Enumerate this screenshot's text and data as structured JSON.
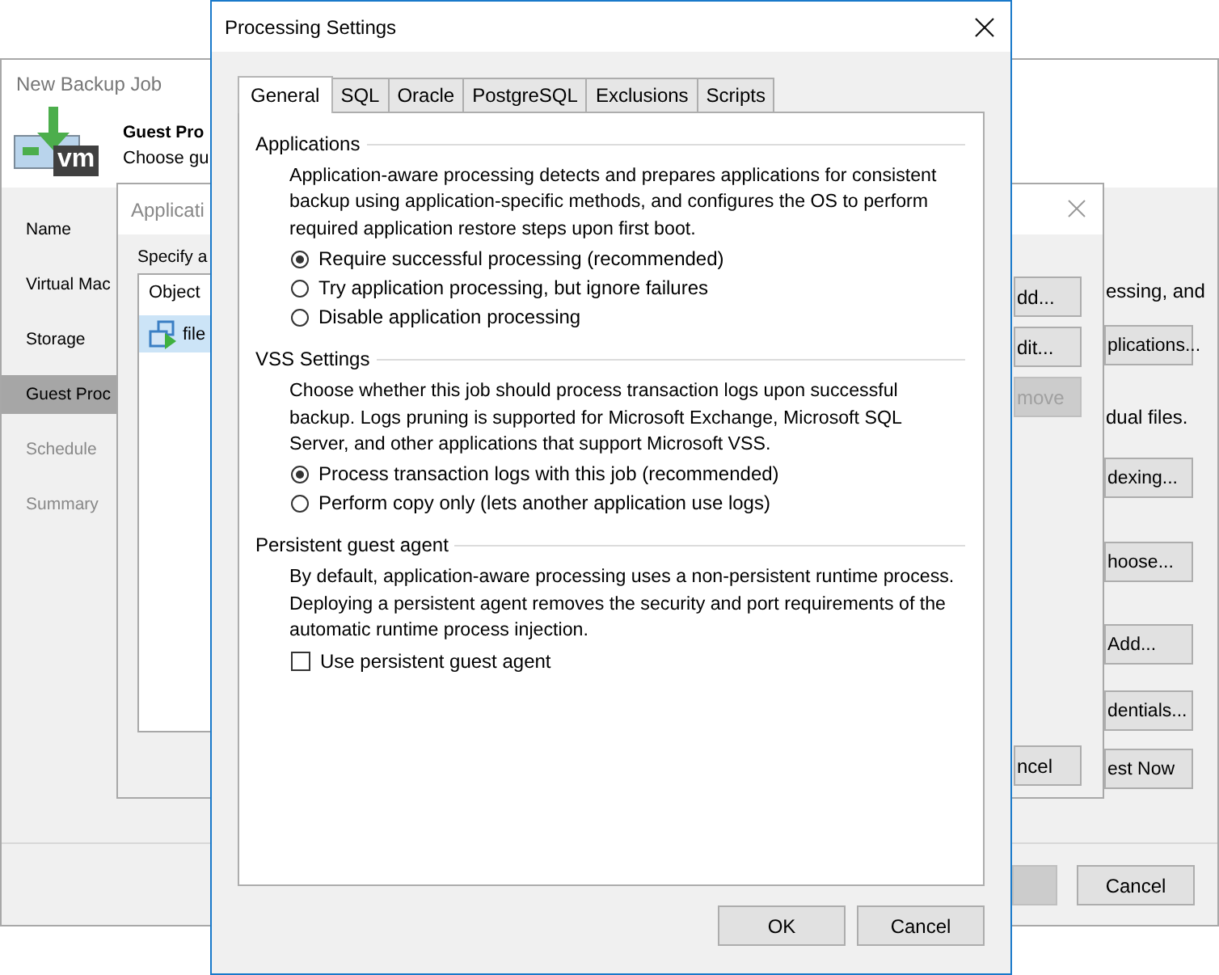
{
  "background_window": {
    "title": "New Backup Job",
    "logo_text": "vm",
    "header_title": "Guest Pro",
    "header_subtitle": "Choose gu",
    "steps": [
      {
        "label": "Name",
        "selected": false,
        "disabled": false
      },
      {
        "label": "Virtual Mac",
        "selected": false,
        "disabled": false
      },
      {
        "label": "Storage",
        "selected": false,
        "disabled": false
      },
      {
        "label": "Guest Proc",
        "selected": true,
        "disabled": false
      },
      {
        "label": "Schedule",
        "selected": false,
        "disabled": true
      },
      {
        "label": "Summary",
        "selected": false,
        "disabled": true
      }
    ],
    "right_items": [
      {
        "kind": "text",
        "label": "essing, and"
      },
      {
        "kind": "button",
        "label": "plications..."
      },
      {
        "kind": "text",
        "label": "dual files."
      },
      {
        "kind": "button",
        "label": "dexing..."
      },
      {
        "kind": "button",
        "label": "hoose..."
      },
      {
        "kind": "button",
        "label": "Add..."
      },
      {
        "kind": "button",
        "label": "dentials..."
      },
      {
        "kind": "button",
        "label": "est Now"
      }
    ],
    "cancel_button": "Cancel"
  },
  "middle_window": {
    "title": "Applicati",
    "prompt": "Specify a",
    "list_header": "Object",
    "rows": [
      {
        "label": "file",
        "selected": true
      }
    ],
    "buttons": [
      {
        "label": "dd...",
        "disabled": false
      },
      {
        "label": "dit...",
        "disabled": false
      },
      {
        "label": "move",
        "disabled": true
      },
      {
        "label": "ncel",
        "disabled": false
      }
    ]
  },
  "window": {
    "title": "Processing Settings",
    "tabs": [
      {
        "label": "General",
        "selected": true
      },
      {
        "label": "SQL",
        "selected": false
      },
      {
        "label": "Oracle",
        "selected": false
      },
      {
        "label": "PostgreSQL",
        "selected": false
      },
      {
        "label": "Exclusions",
        "selected": false
      },
      {
        "label": "Scripts",
        "selected": false
      }
    ],
    "sections": [
      {
        "heading": "Applications",
        "description": "Application-aware processing detects and prepares applications for consistent backup using application-specific methods, and configures the OS to perform required application restore steps upon first boot.",
        "options": [
          {
            "kind": "radio",
            "label": "Require successful processing (recommended)",
            "checked": true
          },
          {
            "kind": "radio",
            "label": "Try application processing, but ignore failures",
            "checked": false
          },
          {
            "kind": "radio",
            "label": "Disable application processing",
            "checked": false
          }
        ]
      },
      {
        "heading": "VSS Settings",
        "description": "Choose whether this job should process transaction logs upon successful backup. Logs pruning is supported for Microsoft Exchange, Microsoft SQL Server, and other applications that support Microsoft VSS.",
        "options": [
          {
            "kind": "radio",
            "label": "Process transaction logs with this job (recommended)",
            "checked": true
          },
          {
            "kind": "radio",
            "label": "Perform copy only (lets another application use logs)",
            "checked": false
          }
        ]
      },
      {
        "heading": "Persistent guest agent",
        "description": "By default, application-aware processing uses a non-persistent runtime process. Deploying a persistent agent removes the security and port requirements of the automatic runtime process injection.",
        "options": [
          {
            "kind": "checkbox",
            "label": "Use persistent guest agent",
            "checked": false
          }
        ]
      }
    ],
    "buttons": [
      "OK",
      "Cancel"
    ]
  }
}
